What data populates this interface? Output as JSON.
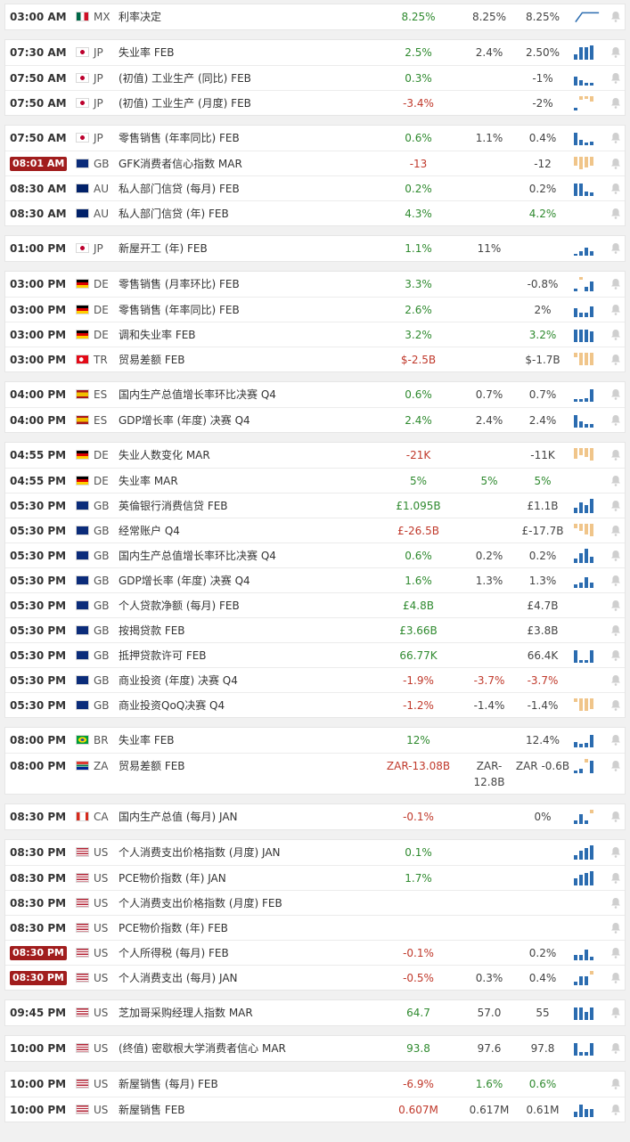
{
  "colors": {
    "positive": "#2f8a2f",
    "negative": "#c0392b",
    "bar": "#2b6cb0",
    "bar_negative": "#f0c58a",
    "highlight_time": "#a11d1d"
  },
  "groups": [
    {
      "rows": [
        {
          "time": "03:00 AM",
          "flag": "mx",
          "ccy": "MX",
          "name": "利率决定",
          "actual": "8.25%",
          "ac": "green",
          "forecast": "8.25%",
          "previous": "8.25%",
          "chart": "line"
        }
      ]
    },
    {
      "rows": [
        {
          "time": "07:30 AM",
          "flag": "jp",
          "ccy": "JP",
          "name": "失业率 FEB",
          "actual": "2.5%",
          "ac": "green",
          "forecast": "2.4%",
          "previous": "2.50%",
          "chart": [
            6,
            14,
            14,
            16
          ]
        },
        {
          "time": "07:50 AM",
          "flag": "jp",
          "ccy": "JP",
          "name": "(初值) 工业生产 (同比) FEB",
          "actual": "0.3%",
          "ac": "green",
          "forecast": "",
          "previous": "-1%",
          "chart": [
            10,
            6,
            3,
            3
          ]
        },
        {
          "time": "07:50 AM",
          "flag": "jp",
          "ccy": "JP",
          "name": "(初值) 工业生产 (月度) FEB",
          "actual": "-3.4%",
          "ac": "red",
          "forecast": "",
          "previous": "-2%",
          "chart": [
            3,
            -4,
            -3,
            -6
          ]
        }
      ]
    },
    {
      "rows": [
        {
          "time": "07:50 AM",
          "flag": "jp",
          "ccy": "JP",
          "name": "零售销售 (年率同比) FEB",
          "actual": "0.6%",
          "ac": "green",
          "forecast": "1.1%",
          "previous": "0.4%",
          "chart": [
            14,
            6,
            3,
            4
          ]
        },
        {
          "time": "08:01 AM",
          "hl": true,
          "flag": "gb",
          "ccy": "GB",
          "name": "GFK消费者信心指数 MAR",
          "actual": "-13",
          "ac": "red",
          "forecast": "",
          "previous": "-12",
          "chart": [
            -10,
            -14,
            -12,
            -10
          ]
        },
        {
          "time": "08:30 AM",
          "flag": "au",
          "ccy": "AU",
          "name": "私人部门信贷 (每月) FEB",
          "actual": "0.2%",
          "ac": "green",
          "forecast": "",
          "previous": "0.2%",
          "chart": [
            14,
            14,
            5,
            4
          ]
        },
        {
          "time": "08:30 AM",
          "flag": "au",
          "ccy": "AU",
          "name": "私人部门信贷 (年) FEB",
          "actual": "4.3%",
          "ac": "green",
          "forecast": "",
          "previous": "4.2%",
          "pc": "green",
          "chart": null
        }
      ]
    },
    {
      "rows": [
        {
          "time": "01:00 PM",
          "flag": "jp",
          "ccy": "JP",
          "name": "新屋开工 (年) FEB",
          "actual": "1.1%",
          "ac": "green",
          "forecast": "11%",
          "previous": "",
          "chart": [
            2,
            5,
            9,
            5
          ]
        }
      ]
    },
    {
      "rows": [
        {
          "time": "03:00 PM",
          "flag": "de",
          "ccy": "DE",
          "name": "零售销售 (月率环比) FEB",
          "actual": "3.3%",
          "ac": "green",
          "forecast": "",
          "previous": "-0.8%",
          "chart": [
            3,
            -3,
            5,
            11
          ]
        },
        {
          "time": "03:00 PM",
          "flag": "de",
          "ccy": "DE",
          "name": "零售销售 (年率同比) FEB",
          "actual": "2.6%",
          "ac": "green",
          "forecast": "",
          "previous": "2%",
          "chart": [
            10,
            5,
            5,
            12
          ]
        },
        {
          "time": "03:00 PM",
          "flag": "de",
          "ccy": "DE",
          "name": "调和失业率 FEB",
          "actual": "3.2%",
          "ac": "green",
          "forecast": "",
          "previous": "3.2%",
          "pc": "green",
          "chart": [
            14,
            14,
            14,
            12
          ]
        },
        {
          "time": "03:00 PM",
          "flag": "tr",
          "ccy": "TR",
          "name": "贸易差额 FEB",
          "actual": "$-2.5B",
          "ac": "red",
          "forecast": "",
          "previous": "$-1.7B",
          "chart": [
            -5,
            -14,
            -14,
            -14
          ]
        }
      ]
    },
    {
      "rows": [
        {
          "time": "04:00 PM",
          "flag": "es",
          "ccy": "ES",
          "name": "国内生产总值增长率环比决赛 Q4",
          "actual": "0.6%",
          "ac": "green",
          "forecast": "0.7%",
          "previous": "0.7%",
          "chart": [
            3,
            3,
            4,
            14
          ]
        },
        {
          "time": "04:00 PM",
          "flag": "es",
          "ccy": "ES",
          "name": "GDP增长率 (年度) 决赛 Q4",
          "actual": "2.4%",
          "ac": "green",
          "forecast": "2.4%",
          "previous": "2.4%",
          "chart": [
            14,
            7,
            4,
            4
          ]
        }
      ]
    },
    {
      "rows": [
        {
          "time": "04:55 PM",
          "flag": "de",
          "ccy": "DE",
          "name": "失业人数变化 MAR",
          "actual": "-21K",
          "ac": "red",
          "forecast": "",
          "previous": "-11K",
          "chart": [
            -12,
            -8,
            -10,
            -14
          ]
        },
        {
          "time": "04:55 PM",
          "flag": "de",
          "ccy": "DE",
          "name": "失业率 MAR",
          "actual": "5%",
          "ac": "green",
          "forecast": "5%",
          "fc": "green",
          "previous": "5%",
          "pc": "green",
          "chart": null
        },
        {
          "time": "05:30 PM",
          "flag": "gb",
          "ccy": "GB",
          "name": "英倫银行消费信贷 FEB",
          "actual": "£1.095B",
          "ac": "green",
          "forecast": "",
          "previous": "£1.1B",
          "chart": [
            6,
            12,
            9,
            16
          ]
        },
        {
          "time": "05:30 PM",
          "flag": "gb",
          "ccy": "GB",
          "name": "经常账户 Q4",
          "actual": "£-26.5B",
          "ac": "red",
          "forecast": "",
          "previous": "£-17.7B",
          "chart": [
            -5,
            -8,
            -12,
            -14
          ]
        },
        {
          "time": "05:30 PM",
          "flag": "gb",
          "ccy": "GB",
          "name": "国内生产总值增长率环比决赛 Q4",
          "actual": "0.6%",
          "ac": "green",
          "forecast": "0.2%",
          "previous": "0.2%",
          "chart": [
            5,
            11,
            16,
            7
          ]
        },
        {
          "time": "05:30 PM",
          "flag": "gb",
          "ccy": "GB",
          "name": "GDP增长率 (年度) 决赛 Q4",
          "actual": "1.6%",
          "ac": "green",
          "forecast": "1.3%",
          "previous": "1.3%",
          "chart": [
            4,
            6,
            12,
            6
          ]
        },
        {
          "time": "05:30 PM",
          "flag": "gb",
          "ccy": "GB",
          "name": "个人贷款净额 (每月) FEB",
          "actual": "£4.8B",
          "ac": "green",
          "forecast": "",
          "previous": "£4.7B",
          "chart": null
        },
        {
          "time": "05:30 PM",
          "flag": "gb",
          "ccy": "GB",
          "name": "按揭贷款 FEB",
          "actual": "£3.66B",
          "ac": "green",
          "forecast": "",
          "previous": "£3.8B",
          "chart": null
        },
        {
          "time": "05:30 PM",
          "flag": "gb",
          "ccy": "GB",
          "name": "抵押贷款许可 FEB",
          "actual": "66.77K",
          "ac": "green",
          "forecast": "",
          "previous": "66.4K",
          "chart": [
            14,
            3,
            3,
            14
          ]
        },
        {
          "time": "05:30 PM",
          "flag": "gb",
          "ccy": "GB",
          "name": "商业投资 (年度) 决赛 Q4",
          "actual": "-1.9%",
          "ac": "red",
          "forecast": "-3.7%",
          "fc": "red",
          "previous": "-3.7%",
          "pc": "red",
          "chart": null
        },
        {
          "time": "05:30 PM",
          "flag": "gb",
          "ccy": "GB",
          "name": "商业投资QoQ决赛 Q4",
          "actual": "-1.2%",
          "ac": "red",
          "forecast": "-1.4%",
          "previous": "-1.4%",
          "chart": [
            -4,
            -14,
            -14,
            -12
          ]
        }
      ]
    },
    {
      "rows": [
        {
          "time": "08:00 PM",
          "flag": "br",
          "ccy": "BR",
          "name": "失业率 FEB",
          "actual": "12%",
          "ac": "green",
          "forecast": "",
          "previous": "12.4%",
          "chart": [
            6,
            4,
            5,
            14
          ]
        },
        {
          "time": "08:00 PM",
          "tall": true,
          "flag": "za",
          "ccy": "ZA",
          "name": "贸易差额 FEB",
          "actual": "ZAR-13.08B",
          "ac": "red",
          "forecast": "ZAR-12.8B",
          "previous": "ZAR -0.6B",
          "chart": [
            3,
            5,
            -4,
            14
          ]
        }
      ]
    },
    {
      "rows": [
        {
          "time": "08:30 PM",
          "flag": "ca",
          "ccy": "CA",
          "name": "国内生产总值 (每月) JAN",
          "actual": "-0.1%",
          "ac": "red",
          "forecast": "",
          "previous": "0%",
          "chart": [
            4,
            11,
            4,
            -4
          ]
        }
      ]
    },
    {
      "rows": [
        {
          "time": "08:30 PM",
          "flag": "us",
          "ccy": "US",
          "name": "个人消费支出价格指数 (月度) JAN",
          "actual": "0.1%",
          "ac": "green",
          "forecast": "",
          "previous": "",
          "chart": [
            5,
            10,
            13,
            16
          ]
        },
        {
          "time": "08:30 PM",
          "flag": "us",
          "ccy": "US",
          "name": "PCE物价指数 (年) JAN",
          "actual": "1.7%",
          "ac": "green",
          "forecast": "",
          "previous": "",
          "chart": [
            8,
            12,
            14,
            16
          ]
        },
        {
          "time": "08:30 PM",
          "flag": "us",
          "ccy": "US",
          "name": "个人消费支出价格指数 (月度) FEB",
          "actual": "",
          "forecast": "",
          "previous": "",
          "chart": null
        },
        {
          "time": "08:30 PM",
          "flag": "us",
          "ccy": "US",
          "name": "PCE物价指数 (年) FEB",
          "actual": "",
          "forecast": "",
          "previous": "",
          "chart": null
        },
        {
          "time": "08:30 PM",
          "hl": true,
          "flag": "us",
          "ccy": "US",
          "name": "个人所得税 (每月) FEB",
          "actual": "-0.1%",
          "ac": "red",
          "forecast": "",
          "previous": "0.2%",
          "chart": [
            6,
            6,
            12,
            4
          ]
        },
        {
          "time": "08:30 PM",
          "hl": true,
          "flag": "us",
          "ccy": "US",
          "name": "个人消费支出 (每月) JAN",
          "actual": "-0.5%",
          "ac": "red",
          "forecast": "0.3%",
          "previous": "0.4%",
          "chart": [
            4,
            10,
            10,
            -4
          ]
        }
      ]
    },
    {
      "rows": [
        {
          "time": "09:45 PM",
          "flag": "us",
          "ccy": "US",
          "name": "芝加哥采购经理人指数 MAR",
          "actual": "64.7",
          "ac": "green",
          "forecast": "57.0",
          "previous": "55",
          "chart": [
            14,
            14,
            9,
            14
          ]
        }
      ]
    },
    {
      "rows": [
        {
          "time": "10:00 PM",
          "flag": "us",
          "ccy": "US",
          "name": "(终值) 密歇根大学消费者信心 MAR",
          "actual": "93.8",
          "ac": "green",
          "forecast": "97.6",
          "previous": "97.8",
          "chart": [
            14,
            4,
            4,
            14
          ]
        }
      ]
    },
    {
      "rows": [
        {
          "time": "10:00 PM",
          "flag": "us",
          "ccy": "US",
          "name": "新屋销售 (每月) FEB",
          "actual": "-6.9%",
          "ac": "red",
          "forecast": "1.6%",
          "fc": "green",
          "previous": "0.6%",
          "pc": "green",
          "chart": null
        },
        {
          "time": "10:00 PM",
          "flag": "us",
          "ccy": "US",
          "name": "新屋销售 FEB",
          "actual": "0.607M",
          "ac": "red",
          "forecast": "0.617M",
          "previous": "0.61M",
          "chart": [
            6,
            14,
            9,
            9
          ]
        }
      ]
    }
  ]
}
